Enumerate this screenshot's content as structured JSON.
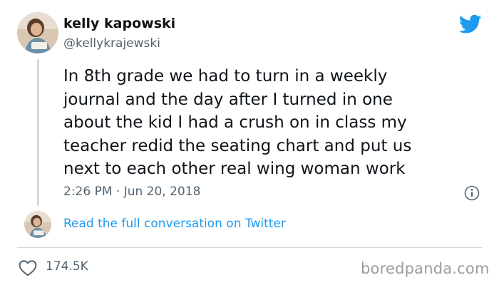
{
  "author": {
    "display_name": "kelly kapowski",
    "handle": "@kellykrajewski",
    "avatar": "user-avatar-photo"
  },
  "tweet": {
    "text": "In 8th grade we had to turn in a weekly\njournal and the day after I turned in one\nabout the kid I had a crush on in class my\nteacher redid the seating chart and put us\nnext to each other real wing woman work",
    "timestamp": "2:26 PM · Jun 20, 2018"
  },
  "actions": {
    "read_conversation": "Read the full conversation on Twitter",
    "likes": "174.5K"
  },
  "icons": {
    "brand": "twitter-bird-icon",
    "info": "info-icon",
    "like": "heart-icon"
  },
  "watermark": "boredpanda.com",
  "colors": {
    "accent": "#1d9bf0",
    "text": "#0f1419",
    "secondary": "#536471",
    "divider": "#cfd9de"
  }
}
